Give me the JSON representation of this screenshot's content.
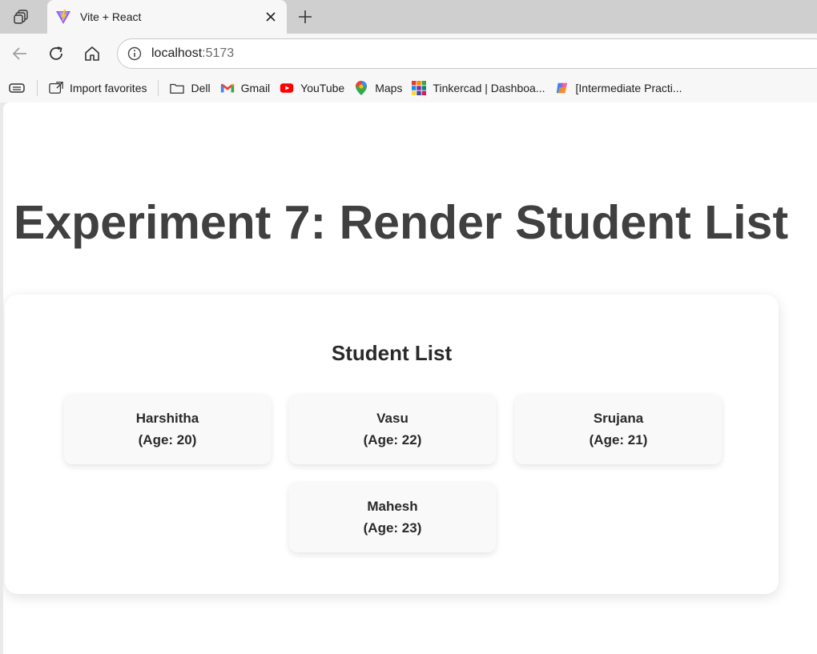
{
  "browser": {
    "tab_title": "Vite + React",
    "url_host": "localhost",
    "url_port": ":5173",
    "favorites": [
      {
        "label": "Import favorites",
        "icon": "import-icon"
      },
      {
        "label": "Dell",
        "icon": "folder-icon"
      },
      {
        "label": "Gmail",
        "icon": "gmail-icon"
      },
      {
        "label": "YouTube",
        "icon": "youtube-icon"
      },
      {
        "label": "Maps",
        "icon": "maps-icon"
      },
      {
        "label": "Tinkercad | Dashboa...",
        "icon": "tinkercad-icon"
      },
      {
        "label": "[Intermediate Practi...",
        "icon": "copilot-icon"
      }
    ]
  },
  "page": {
    "title": "Experiment 7: Render Student List",
    "card_title": "Student List",
    "students": [
      {
        "name": "Harshitha",
        "age": "(Age: 20)"
      },
      {
        "name": "Vasu",
        "age": "(Age: 22)"
      },
      {
        "name": "Srujana",
        "age": "(Age: 21)"
      },
      {
        "name": "Mahesh",
        "age": "(Age: 23)"
      }
    ]
  },
  "colors": {
    "title_text": "#404040",
    "card_bg": "#ffffff",
    "student_bg": "#f9f9f9",
    "youtube_red": "#ff0000"
  }
}
